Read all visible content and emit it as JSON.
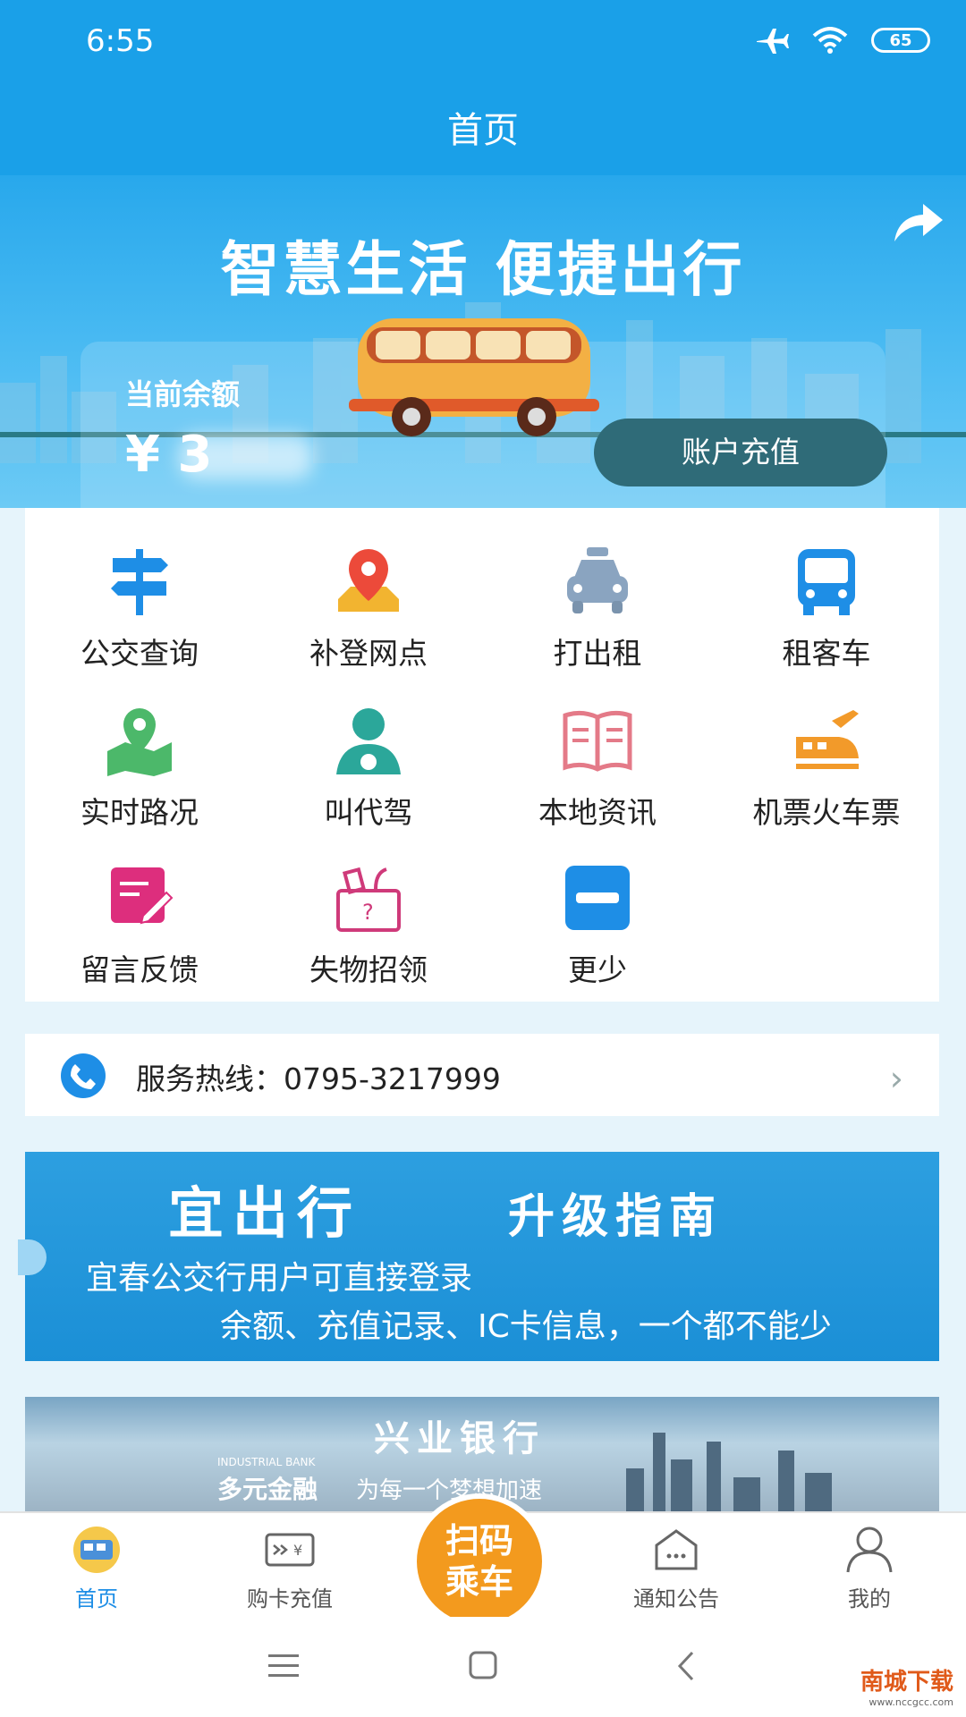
{
  "status": {
    "time": "6:55",
    "battery": "65"
  },
  "header": {
    "title": "首页"
  },
  "hero": {
    "slogan": "智慧生活 便捷出行",
    "balance_label": "当前余额",
    "balance_value": "¥ 3",
    "recharge_label": "账户充值"
  },
  "services": [
    {
      "label": "公交查询",
      "icon": "signpost-icon"
    },
    {
      "label": "补登网点",
      "icon": "location-pin-icon"
    },
    {
      "label": "打出租",
      "icon": "taxi-icon"
    },
    {
      "label": "租客车",
      "icon": "bus-icon"
    },
    {
      "label": "实时路况",
      "icon": "map-icon"
    },
    {
      "label": "叫代驾",
      "icon": "driver-icon"
    },
    {
      "label": "本地资讯",
      "icon": "book-icon"
    },
    {
      "label": "机票火车票",
      "icon": "train-plane-icon"
    },
    {
      "label": "留言反馈",
      "icon": "feedback-icon"
    },
    {
      "label": "失物招领",
      "icon": "lost-found-icon"
    },
    {
      "label": "更少",
      "icon": "minus-icon"
    }
  ],
  "hotline": {
    "text": "服务热线：0795-3217999"
  },
  "banner1": {
    "title1": "宜出行",
    "title2": "升级指南",
    "line1": "宜春公交行用户可直接登录",
    "line2": "余额、充值记录、IC卡信息，一个都不能少"
  },
  "banner2": {
    "title": "兴业银行",
    "small": "INDUSTRIAL BANK",
    "brand": "多元金融",
    "tagline": "为每一个梦想加速"
  },
  "tabs": [
    {
      "label": "首页",
      "active": true
    },
    {
      "label": "购卡充值",
      "active": false
    },
    {
      "label": "通知公告",
      "active": false
    },
    {
      "label": "我的",
      "active": false
    }
  ],
  "scan": {
    "line1": "扫码",
    "line2": "乘车"
  },
  "watermark": {
    "text": "南城下载",
    "url": "www.nccgcc.com"
  },
  "colors": {
    "primary": "#1aa0e8",
    "accent": "#f39a1e",
    "dark_button": "#2f6b78"
  }
}
